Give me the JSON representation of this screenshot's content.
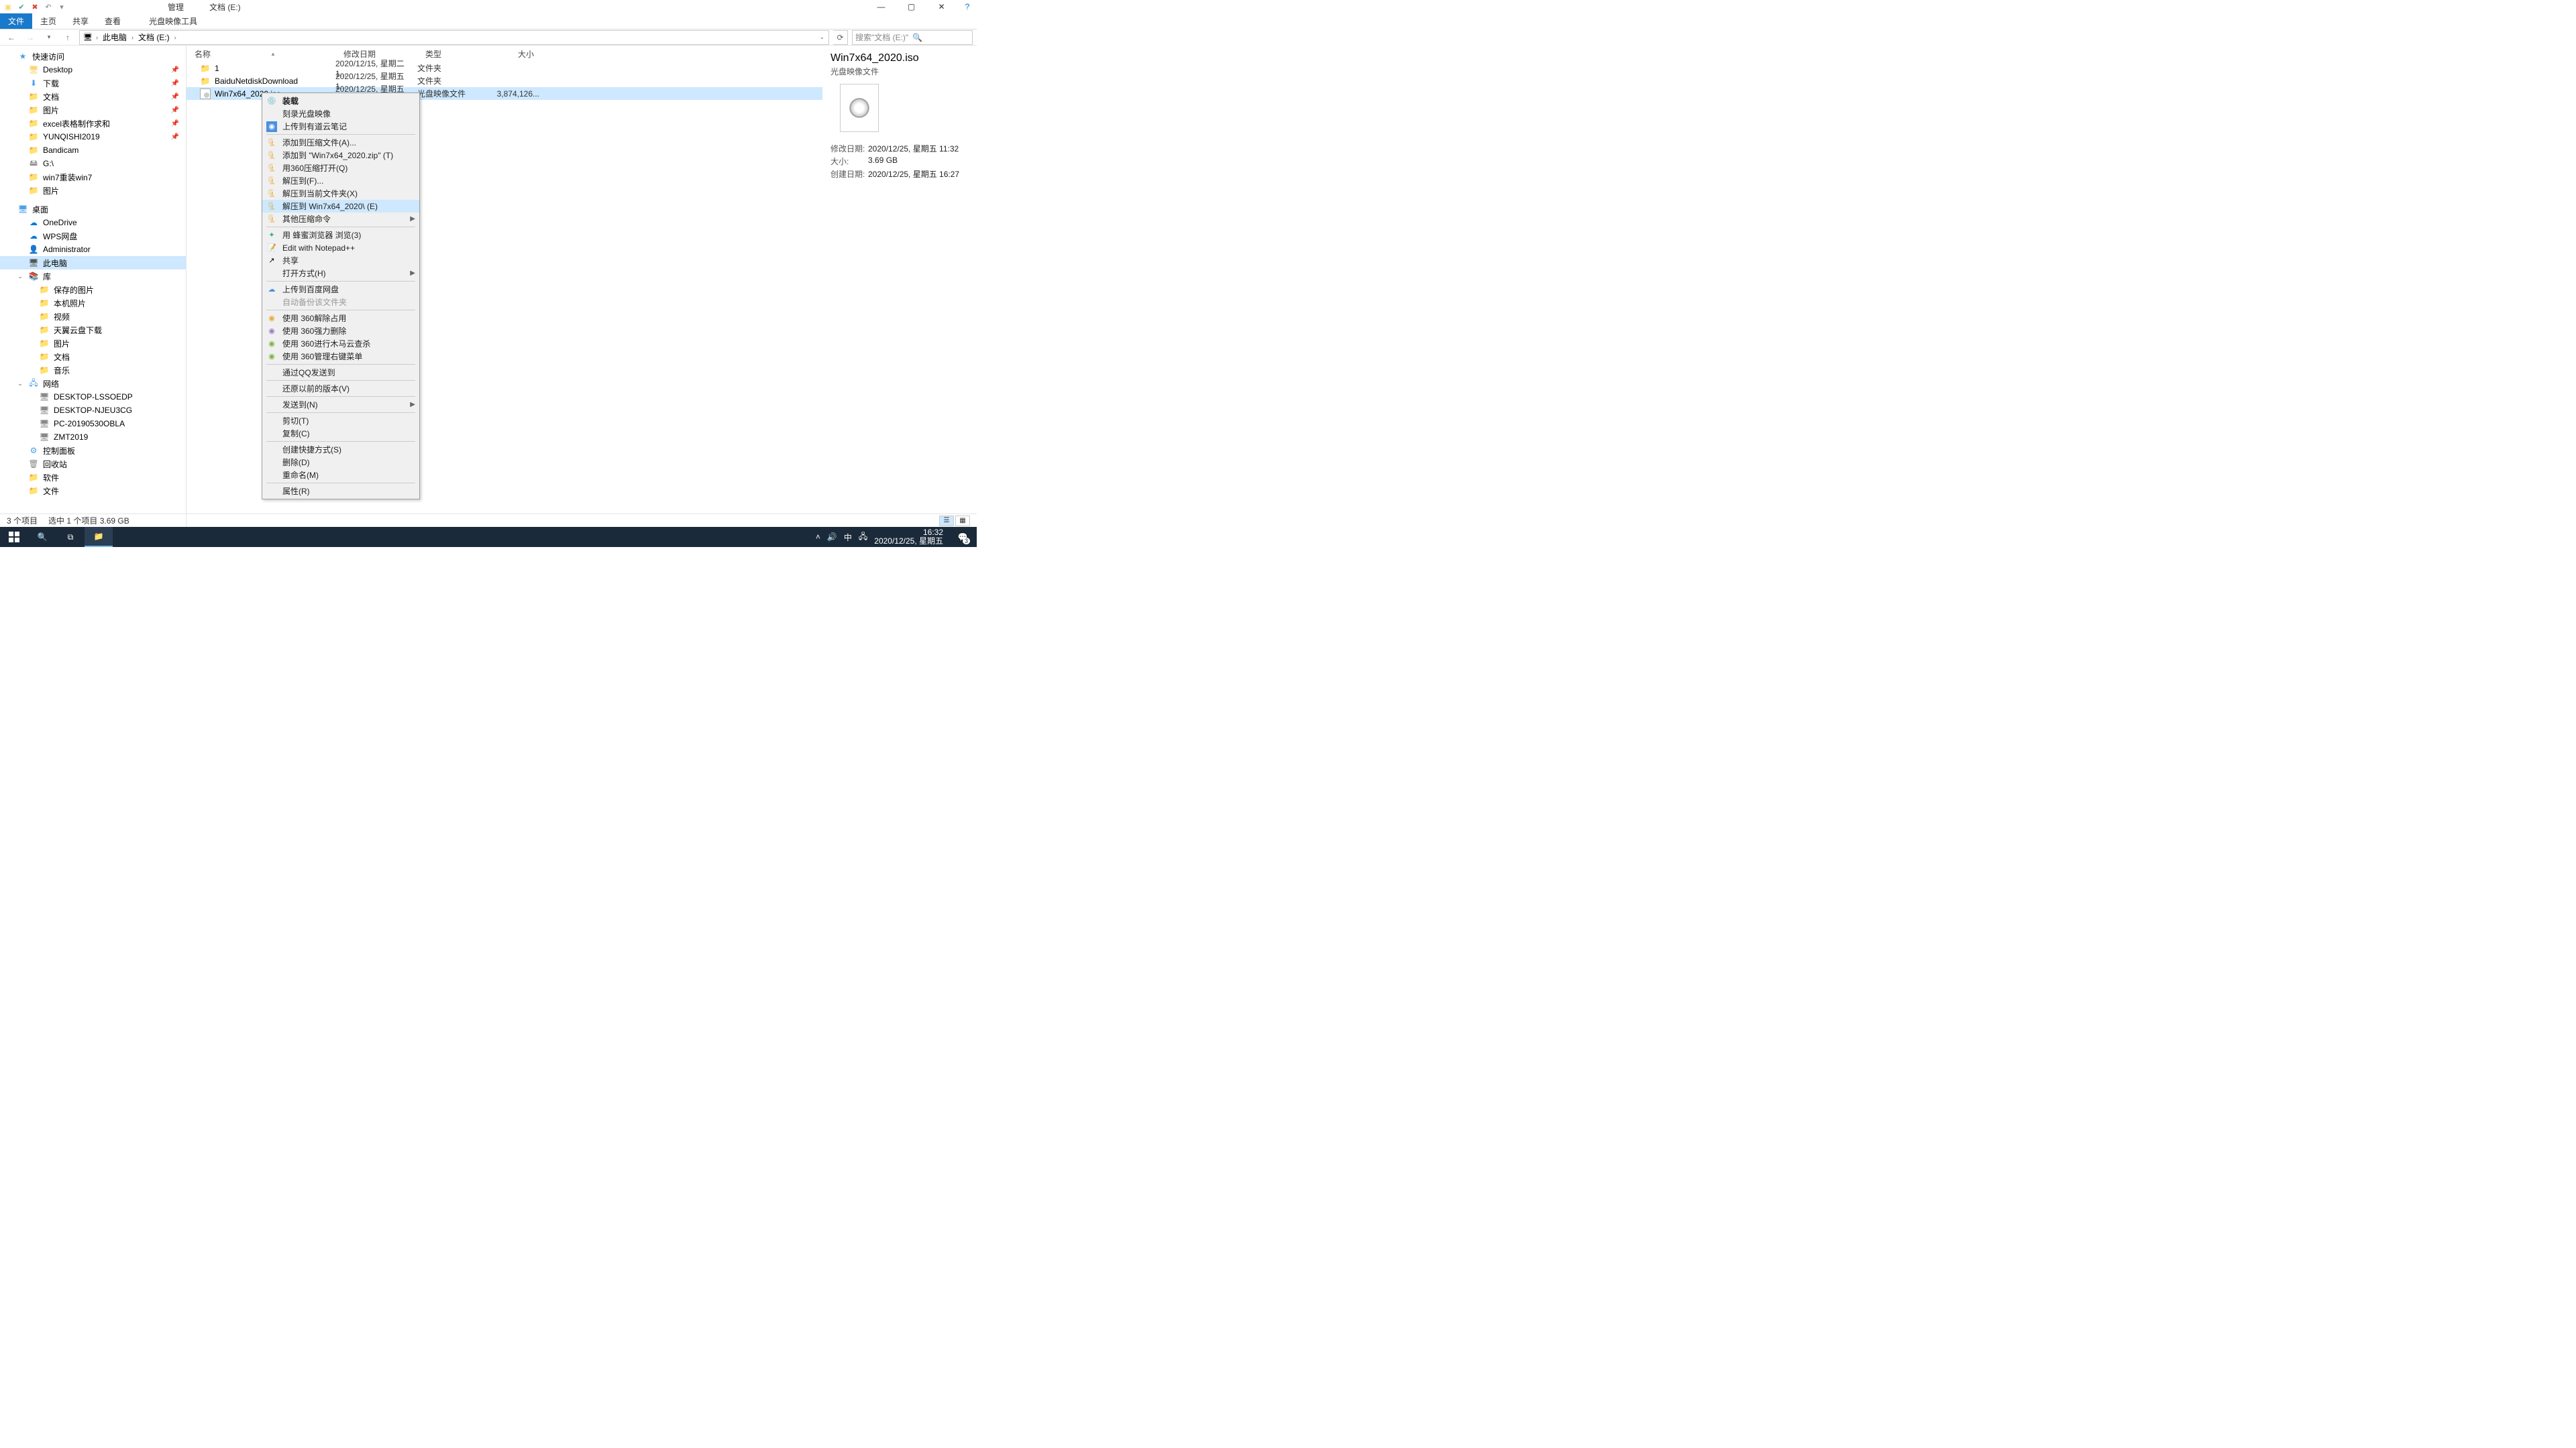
{
  "titlebar": {
    "manage_label": "管理",
    "title": "文档 (E:)"
  },
  "ribbon": {
    "file": "文件",
    "home": "主页",
    "share": "共享",
    "view": "查看",
    "ctx": "光盘映像工具"
  },
  "breadcrumb": {
    "seg0": "此电脑",
    "seg1": "文档 (E:)"
  },
  "search": {
    "placeholder": "搜索\"文档 (E:)\""
  },
  "nav": {
    "quick": "快速访问",
    "desktop": "Desktop",
    "downloads": "下载",
    "docs": "文档",
    "pics": "图片",
    "excel": "excel表格制作求和",
    "yunqishi": "YUNQISHI2019",
    "bandicam": "Bandicam",
    "g": "G:\\",
    "win7re": "win7重装win7",
    "pics2": "图片",
    "desk2": "桌面",
    "onedrive": "OneDrive",
    "wps": "WPS网盘",
    "admin": "Administrator",
    "thispc": "此电脑",
    "lib": "库",
    "saved": "保存的图片",
    "camera": "本机照片",
    "video": "视频",
    "tianyi": "天翼云盘下载",
    "pics3": "图片",
    "docs2": "文档",
    "music": "音乐",
    "network": "网络",
    "pc1": "DESKTOP-LSSOEDP",
    "pc2": "DESKTOP-NJEU3CG",
    "pc3": "PC-20190530OBLA",
    "pc4": "ZMT2019",
    "ctrl": "控制面板",
    "recycle": "回收站",
    "soft": "软件",
    "file": "文件"
  },
  "cols": {
    "name": "名称",
    "date": "修改日期",
    "type": "类型",
    "size": "大小"
  },
  "rows": [
    {
      "name": "1",
      "date": "2020/12/15, 星期二 1...",
      "type": "文件夹",
      "size": ""
    },
    {
      "name": "BaiduNetdiskDownload",
      "date": "2020/12/25, 星期五 1...",
      "type": "文件夹",
      "size": ""
    },
    {
      "name": "Win7x64_2020.iso",
      "date": "2020/12/25, 星期五 1...",
      "type": "光盘映像文件",
      "size": "3,874,126..."
    }
  ],
  "ctx": {
    "mount": "装载",
    "burn": "刻录光盘映像",
    "youdao": "上传到有道云笔记",
    "addarch": "添加到压缩文件(A)...",
    "addzip": "添加到 \"Win7x64_2020.zip\" (T)",
    "open360": "用360压缩打开(Q)",
    "extractF": "解压到(F)...",
    "extractHere": "解压到当前文件夹(X)",
    "extractName": "解压到 Win7x64_2020\\ (E)",
    "otherzip": "其他压缩命令",
    "bee": "用 蜂蜜浏览器 浏览(3)",
    "npp": "Edit with Notepad++",
    "share": "共享",
    "openwith": "打开方式(H)",
    "baidu": "上传到百度网盘",
    "autobak": "自动备份该文件夹",
    "unlock360": "使用 360解除占用",
    "forcedel360": "使用 360强力删除",
    "trojan360": "使用 360进行木马云查杀",
    "menu360": "使用 360管理右键菜单",
    "qq": "通过QQ发送到",
    "restore": "还原以前的版本(V)",
    "sendto": "发送到(N)",
    "cut": "剪切(T)",
    "copy": "复制(C)",
    "shortcut": "创建快捷方式(S)",
    "delete": "删除(D)",
    "rename": "重命名(M)",
    "props": "属性(R)"
  },
  "details": {
    "title": "Win7x64_2020.iso",
    "type": "光盘映像文件",
    "l_mod": "修改日期:",
    "v_mod": "2020/12/25, 星期五 11:32",
    "l_size": "大小:",
    "v_size": "3.69 GB",
    "l_create": "创建日期:",
    "v_create": "2020/12/25, 星期五 16:27"
  },
  "status": {
    "count": "3 个项目",
    "sel": "选中 1 个项目  3.69 GB"
  },
  "tray": {
    "ime": "中",
    "time": "16:32",
    "date": "2020/12/25, 星期五",
    "badge": "3"
  }
}
